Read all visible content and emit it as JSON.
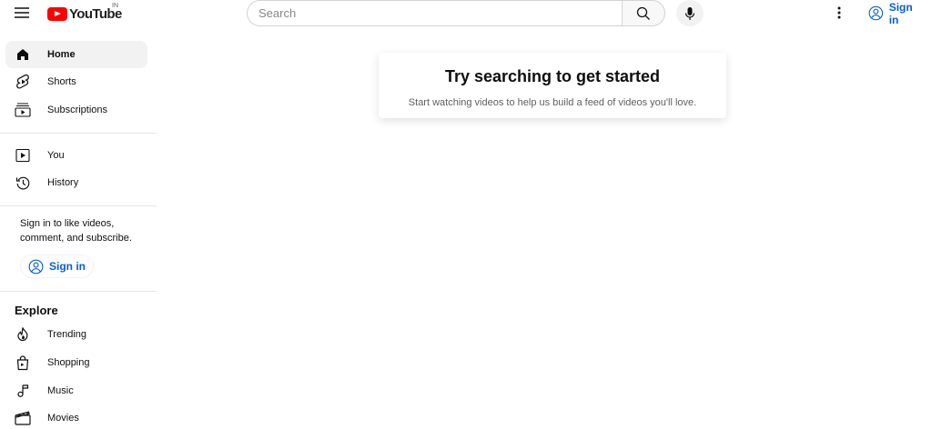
{
  "header": {
    "logo_text": "YouTube",
    "country_code": "IN",
    "search_placeholder": "Search",
    "signin_label": "Sign in"
  },
  "sidebar": {
    "primary": [
      {
        "label": "Home",
        "icon": "home-icon",
        "active": true
      },
      {
        "label": "Shorts",
        "icon": "shorts-icon"
      },
      {
        "label": "Subscriptions",
        "icon": "subscriptions-icon"
      }
    ],
    "secondary": [
      {
        "label": "You",
        "icon": "you-icon"
      },
      {
        "label": "History",
        "icon": "history-icon"
      }
    ],
    "signin_prompt": "Sign in to like videos, comment, and subscribe.",
    "signin_label": "Sign in",
    "explore_title": "Explore",
    "explore": [
      {
        "label": "Trending",
        "icon": "trending-icon"
      },
      {
        "label": "Shopping",
        "icon": "shopping-icon"
      },
      {
        "label": "Music",
        "icon": "music-icon"
      },
      {
        "label": "Movies",
        "icon": "movies-icon"
      }
    ]
  },
  "main": {
    "title": "Try searching to get started",
    "subtitle": "Start watching videos to help us build a feed of videos you'll love."
  },
  "colors": {
    "brand_red": "#ff0000",
    "link_blue": "#065fd4",
    "active_bg": "#f2f2f2"
  }
}
